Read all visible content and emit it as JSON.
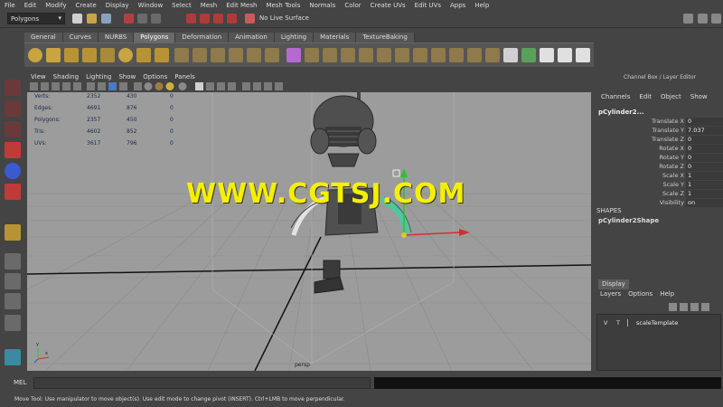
{
  "menubar": [
    "File",
    "Edit",
    "Modify",
    "Create",
    "Display",
    "Window",
    "Select",
    "Mesh",
    "Edit Mesh",
    "Mesh Tools",
    "Normals",
    "Color",
    "Create UVs",
    "Edit UVs",
    "Apps",
    "Help"
  ],
  "status": {
    "mode": "Polygons",
    "live_surface": "No Live Surface"
  },
  "shelf": {
    "tabs": [
      "General",
      "Curves",
      "NURBS",
      "Polygons",
      "Deformation",
      "Animation",
      "Lighting",
      "Materials",
      "TextureBaking"
    ],
    "active_tab": "Polygons"
  },
  "viewport": {
    "menu": [
      "View",
      "Shading",
      "Lighting",
      "Show",
      "Options",
      "Panels"
    ],
    "hud": [
      {
        "label": "Verts:",
        "a": "2352",
        "b": "430",
        "c": "0"
      },
      {
        "label": "Edges:",
        "a": "4691",
        "b": "876",
        "c": "0"
      },
      {
        "label": "Polygons:",
        "a": "2357",
        "b": "450",
        "c": "0"
      },
      {
        "label": "Tris:",
        "a": "4602",
        "b": "852",
        "c": "0"
      },
      {
        "label": "UVs:",
        "a": "3617",
        "b": "796",
        "c": "0"
      }
    ],
    "camera_label": "persp",
    "watermark": "WWW.CGTSJ.COM",
    "axis_x": "x",
    "axis_y": "y"
  },
  "channel_box": {
    "title": "Channel Box / Layer Editor",
    "menu": [
      "Channels",
      "Edit",
      "Object",
      "Show"
    ],
    "object": "pCylinder2...",
    "attributes": [
      {
        "name": "Translate X",
        "value": "0"
      },
      {
        "name": "Translate Y",
        "value": "7.037"
      },
      {
        "name": "Translate Z",
        "value": "0"
      },
      {
        "name": "Rotate X",
        "value": "0"
      },
      {
        "name": "Rotate Y",
        "value": "0"
      },
      {
        "name": "Rotate Z",
        "value": "0"
      },
      {
        "name": "Scale X",
        "value": "1"
      },
      {
        "name": "Scale Y",
        "value": "1"
      },
      {
        "name": "Scale Z",
        "value": "1"
      },
      {
        "name": "Visibility",
        "value": "on"
      }
    ],
    "shapes_label": "SHAPES",
    "shape_name": "pCylinder2Shape"
  },
  "layer_editor": {
    "tab": "Display",
    "menu": [
      "Layers",
      "Options",
      "Help"
    ],
    "layer": {
      "v": "V",
      "t": "T",
      "name": "scaleTemplate"
    }
  },
  "command_line": {
    "label": "MEL"
  },
  "help_line": "Move Tool: Use manipulator to move object(s). Use edit mode to change pivot (INSERT). Ctrl+LMB to move perpendicular.",
  "colors": {
    "ui_bg": "#444444",
    "viewport_bg": "#9c9c9c",
    "watermark": "#f5f000",
    "select_highlight": "#3f5f7f"
  }
}
